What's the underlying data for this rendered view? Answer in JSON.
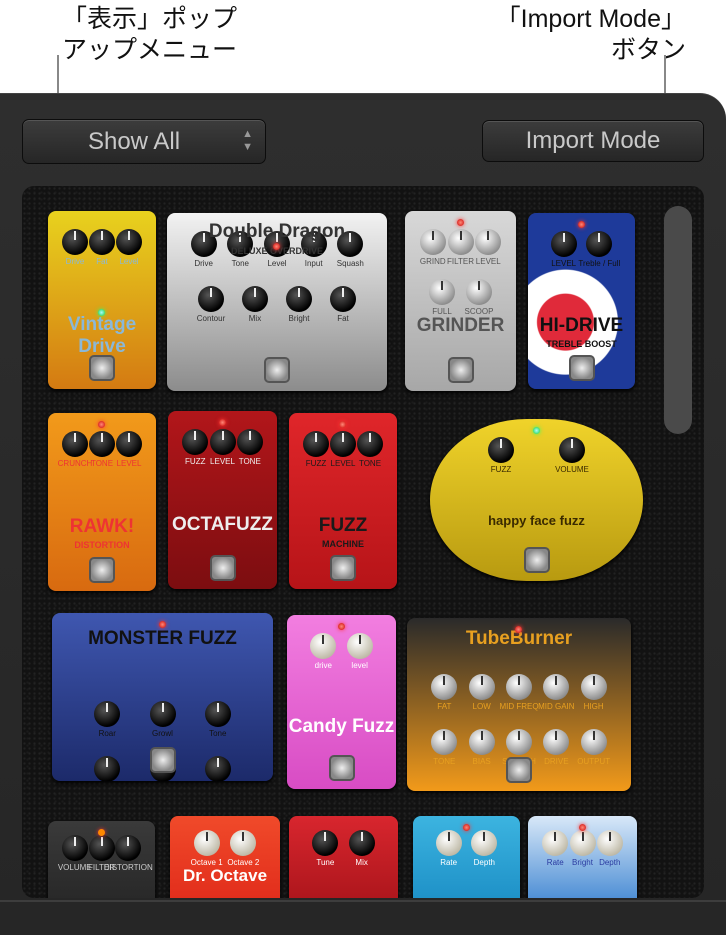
{
  "callouts": {
    "left": {
      "line1": "「表示」ポップ",
      "line2": "アップメニュー"
    },
    "right": {
      "line1": "「Import Mode」",
      "line2": "ボタン"
    }
  },
  "toolbar": {
    "show_all_label": "Show All",
    "show_all_arrows": "▲▼",
    "import_mode_label": "Import Mode"
  },
  "pedals": [
    {
      "name": "Vintage Drive",
      "sub": "",
      "colors": [
        "#e8d21e",
        "#d47a12"
      ],
      "text": "#8ab8d8",
      "knobs": [
        "Drive",
        "Fat",
        "Level"
      ],
      "led": "green"
    },
    {
      "name": "Double Dragon",
      "sub": "DELUXE OVERDRIVE",
      "colors": [
        "#f2f2f2",
        "#8c8c8c"
      ],
      "text": "#333",
      "knobs": [
        "Drive",
        "Tone",
        "Level",
        "Input",
        "Squash",
        "Contour",
        "Mix",
        "Bright",
        "Fat"
      ],
      "led": "red"
    },
    {
      "name": "GRINDER",
      "sub": "",
      "colors": [
        "#d8d8d8",
        "#a7a7a7"
      ],
      "text": "#555",
      "knobs": [
        "GRIND",
        "FILTER",
        "LEVEL",
        "FULL",
        "SCOOP"
      ],
      "led": "red"
    },
    {
      "name": "HI-DRIVE",
      "sub": "TREBLE BOOST",
      "colors": [
        "#ffffff",
        "#1e3a9a"
      ],
      "text": "#111",
      "knobs": [
        "LEVEL",
        "Treble / Full"
      ],
      "led": "red"
    },
    {
      "name": "RAWK!",
      "sub": "DISTORTION",
      "colors": [
        "#f29a1a",
        "#d86a10"
      ],
      "text": "#e33",
      "knobs": [
        "CRUNCH",
        "TONE",
        "LEVEL"
      ],
      "led": "red"
    },
    {
      "name": "OCTAFUZZ",
      "sub": "",
      "colors": [
        "#b2161a",
        "#7c0d10"
      ],
      "text": "#eee",
      "knobs": [
        "FUZZ",
        "LEVEL",
        "TONE"
      ],
      "led": "red"
    },
    {
      "name": "FUZZ",
      "sub": "MACHINE",
      "colors": [
        "#e0262a",
        "#b61418"
      ],
      "text": "#1a1a1a",
      "knobs": [
        "FUZZ",
        "LEVEL",
        "TONE"
      ],
      "led": "red"
    },
    {
      "name": "happy face fuzz",
      "sub": "",
      "colors": [
        "#f0d32a",
        "#b89a10"
      ],
      "text": "#3a2a00",
      "knobs": [
        "FUZZ",
        "VOLUME"
      ],
      "led": "green"
    },
    {
      "name": "MONSTER FUZZ",
      "sub": "",
      "colors": [
        "#3f57b0",
        "#1c2a6a"
      ],
      "text": "#111",
      "knobs": [
        "Roar",
        "Growl",
        "Tone",
        "Texture",
        "Grain",
        "Level"
      ],
      "led": "red"
    },
    {
      "name": "Candy Fuzz",
      "sub": "",
      "colors": [
        "#f27ee0",
        "#d84cc4"
      ],
      "text": "#fff",
      "knobs": [
        "drive",
        "level"
      ],
      "led": "red"
    },
    {
      "name": "TubeBurner",
      "sub": "",
      "colors": [
        "#2a2a2a",
        "#f29a1a"
      ],
      "text": "#e8a020",
      "knobs": [
        "FAT",
        "LOW",
        "MID FREQ",
        "MID GAIN",
        "HIGH",
        "TONE",
        "BIAS",
        "SQUASH",
        "DRIVE",
        "OUTPUT"
      ],
      "led": "red"
    },
    {
      "name": "",
      "sub": "",
      "colors": [
        "#3a3a3a",
        "#262626"
      ],
      "text": "#ccc",
      "knobs": [
        "VOLUME",
        "FILTER",
        "DISTORTION"
      ],
      "led": "orange"
    },
    {
      "name": "Dr. Octave",
      "sub": "",
      "colors": [
        "#f04a2a",
        "#e02a1a"
      ],
      "text": "#fff",
      "knobs": [
        "Octave 1",
        "Octave 2"
      ],
      "led": ""
    },
    {
      "name": "",
      "sub": "",
      "colors": [
        "#d8262e",
        "#a8141a"
      ],
      "text": "#fff",
      "knobs": [
        "Tune",
        "Mix"
      ],
      "led": ""
    },
    {
      "name": "",
      "sub": "",
      "colors": [
        "#3cb4e0",
        "#1a8cc4"
      ],
      "text": "#fff",
      "knobs": [
        "Rate",
        "Depth"
      ],
      "led": "red"
    },
    {
      "name": "",
      "sub": "",
      "colors": [
        "#d8e8f8",
        "#3a82d0"
      ],
      "text": "#2a3aa0",
      "knobs": [
        "Rate",
        "Bright",
        "Depth"
      ],
      "led": "red"
    }
  ]
}
